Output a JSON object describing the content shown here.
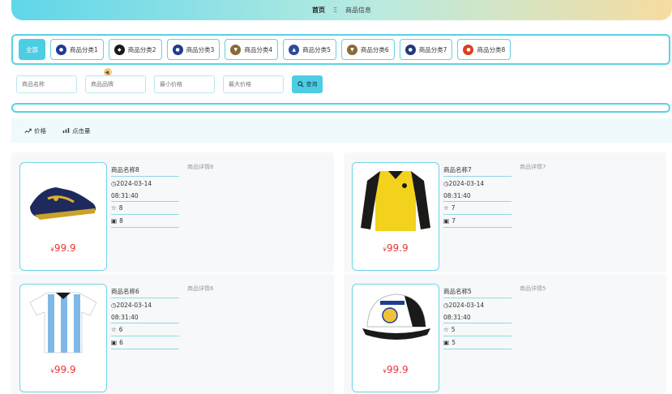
{
  "nav": {
    "home": "首页",
    "separator": "Ξ",
    "current": "商品信息"
  },
  "categories": [
    {
      "label": "全部",
      "active": true
    },
    {
      "label": "商品分类1",
      "icon": "club-badge-icon",
      "color": "#1e3d8f"
    },
    {
      "label": "商品分类2",
      "icon": "club-badge-icon",
      "color": "#1a1a1a"
    },
    {
      "label": "商品分类3",
      "icon": "club-badge-icon",
      "color": "#1e3d8f"
    },
    {
      "label": "商品分类4",
      "icon": "club-badge-icon",
      "color": "#8a6a3a"
    },
    {
      "label": "商品分类5",
      "icon": "club-badge-icon",
      "color": "#2a4a9a"
    },
    {
      "label": "商品分类6",
      "icon": "club-badge-icon",
      "color": "#8a6a3a"
    },
    {
      "label": "商品分类7",
      "icon": "club-badge-icon",
      "color": "#223a7a"
    },
    {
      "label": "商品分类8",
      "icon": "club-badge-icon",
      "color": "#d9401e"
    }
  ],
  "search": {
    "name_placeholder": "商品名称",
    "brand_placeholder": "商品品牌",
    "min_price_placeholder": "最小价格",
    "max_price_placeholder": "最大价格",
    "button_label": "查询"
  },
  "sort": {
    "price": "价格",
    "clicks": "点击量"
  },
  "products": [
    {
      "name": "商品名称8",
      "date": "2024-03-14",
      "time": "08:31:40",
      "favorites": "8",
      "views": "8",
      "detail": "商品详情8",
      "currency": "¥",
      "price": "99.9",
      "image": "shoe"
    },
    {
      "name": "商品名称7",
      "date": "2024-03-14",
      "time": "08:31:40",
      "favorites": "7",
      "views": "7",
      "detail": "商品详情7",
      "currency": "¥",
      "price": "99.9",
      "image": "jacket"
    },
    {
      "name": "商品名称6",
      "date": "2024-03-14",
      "time": "08:31:40",
      "favorites": "6",
      "views": "6",
      "detail": "商品详情6",
      "currency": "¥",
      "price": "99.9",
      "image": "jersey"
    },
    {
      "name": "商品名称5",
      "date": "2024-03-14",
      "time": "08:31:40",
      "favorites": "5",
      "views": "5",
      "detail": "商品详情5",
      "currency": "¥",
      "price": "99.9",
      "image": "cap"
    }
  ]
}
